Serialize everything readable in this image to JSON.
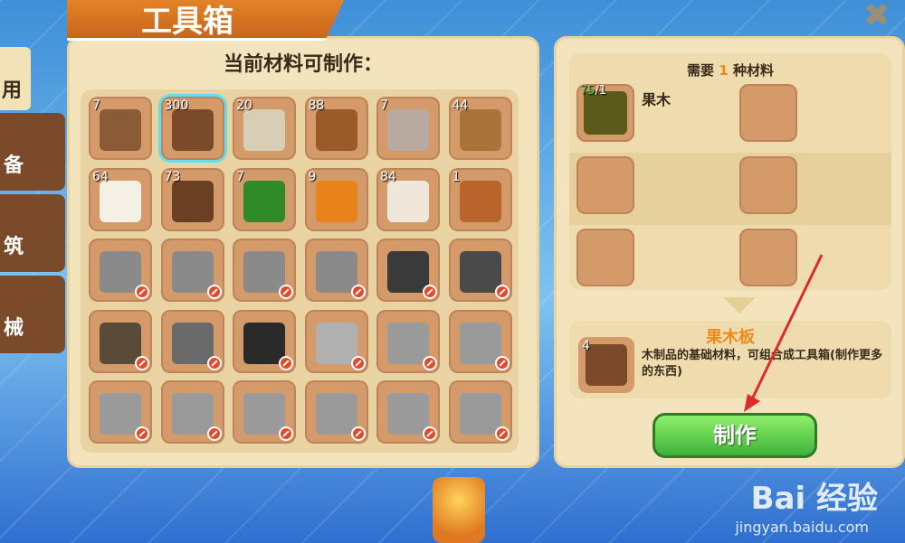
{
  "window": {
    "title": "工具箱",
    "close_label": "✖"
  },
  "side_tabs": [
    {
      "label": "用",
      "icon": "tool-icon"
    },
    {
      "label": "备",
      "icon": "equipment-icon"
    },
    {
      "label": "筑",
      "icon": "building-icon"
    },
    {
      "label": "械",
      "icon": "gear-icon"
    }
  ],
  "left_panel": {
    "title": "当前材料可制作：",
    "items": [
      {
        "count": "7",
        "icon": "workbench-icon",
        "color": "#8b5a36",
        "locked": false
      },
      {
        "count": "300",
        "icon": "fruit-wood-plank-icon",
        "color": "#7a4a2a",
        "locked": false,
        "selected": true
      },
      {
        "count": "20",
        "icon": "birch-plank-icon",
        "color": "#d8cdb5",
        "locked": false
      },
      {
        "count": "88",
        "icon": "stick-icon",
        "color": "#9b5a2a",
        "locked": false
      },
      {
        "count": "7",
        "icon": "furnace-icon",
        "color": "#b8aaa0",
        "locked": false
      },
      {
        "count": "44",
        "icon": "bowl-icon",
        "color": "#a8743a",
        "locked": false
      },
      {
        "count": "64",
        "icon": "flour-icon",
        "color": "#f4f0e6",
        "locked": false
      },
      {
        "count": "73",
        "icon": "seeds-icon",
        "color": "#6a3f22",
        "locked": false
      },
      {
        "count": "7",
        "icon": "watermelon-icon",
        "color": "#2f8a2a",
        "locked": false
      },
      {
        "count": "9",
        "icon": "orange-pellets-icon",
        "color": "#e8821a",
        "locked": false
      },
      {
        "count": "84",
        "icon": "paper-icon",
        "color": "#efe8da",
        "locked": false
      },
      {
        "count": "1",
        "icon": "wooden-bucket-icon",
        "color": "#b8642a",
        "locked": false
      },
      {
        "count": "",
        "icon": "stone-axe-icon",
        "color": "#8a8a8a",
        "locked": true
      },
      {
        "count": "",
        "icon": "stone-pickaxe-icon",
        "color": "#8a8a8a",
        "locked": true
      },
      {
        "count": "",
        "icon": "stone-shovel-icon",
        "color": "#8a8a8a",
        "locked": true
      },
      {
        "count": "",
        "icon": "stone-hoe-icon",
        "color": "#8a8a8a",
        "locked": true
      },
      {
        "count": "",
        "icon": "chest-icon",
        "color": "#3a3a3a",
        "locked": true
      },
      {
        "count": "",
        "icon": "iron-door-icon",
        "color": "#4a4a4a",
        "locked": true
      },
      {
        "count": "",
        "icon": "ladder-icon",
        "color": "#5a4a3a",
        "locked": true
      },
      {
        "count": "",
        "icon": "bed-icon",
        "color": "#6a6a6a",
        "locked": true
      },
      {
        "count": "",
        "icon": "signboard-icon",
        "color": "#2a2a2a",
        "locked": true
      },
      {
        "count": "",
        "icon": "metal-bucket-icon",
        "color": "#b0b0b0",
        "locked": true
      },
      {
        "count": "",
        "icon": "iron-axe-icon",
        "color": "#9a9a9a",
        "locked": true
      },
      {
        "count": "",
        "icon": "iron-axe-2-icon",
        "color": "#9a9a9a",
        "locked": true
      },
      {
        "count": "",
        "icon": "chainsaw-icon",
        "color": "#9a9a9a",
        "locked": true
      },
      {
        "count": "",
        "icon": "iron-pickaxe-icon",
        "color": "#9a9a9a",
        "locked": true
      },
      {
        "count": "",
        "icon": "iron-pickaxe-2-icon",
        "color": "#9a9a9a",
        "locked": true
      },
      {
        "count": "",
        "icon": "drill-icon",
        "color": "#9a9a9a",
        "locked": true
      },
      {
        "count": "",
        "icon": "iron-shovel-icon",
        "color": "#9a9a9a",
        "locked": true
      },
      {
        "count": "",
        "icon": "iron-shovel-2-icon",
        "color": "#9a9a9a",
        "locked": true
      }
    ]
  },
  "right_panel": {
    "need_prefix": "需要",
    "need_count": "1",
    "need_suffix": "种材料",
    "material": {
      "have": "75",
      "need": "/1",
      "name": "果木",
      "icon": "fruit-wood-log-icon"
    },
    "result": {
      "name": "果木板",
      "count": "4",
      "description": "木制品的基础材料，可组合成工具箱(制作更多的东西)",
      "icon": "fruit-wood-plank-icon"
    },
    "make_button_label": "制作"
  },
  "watermark": {
    "brand": "Bai 经验",
    "url": "jingyan.baidu.com"
  }
}
